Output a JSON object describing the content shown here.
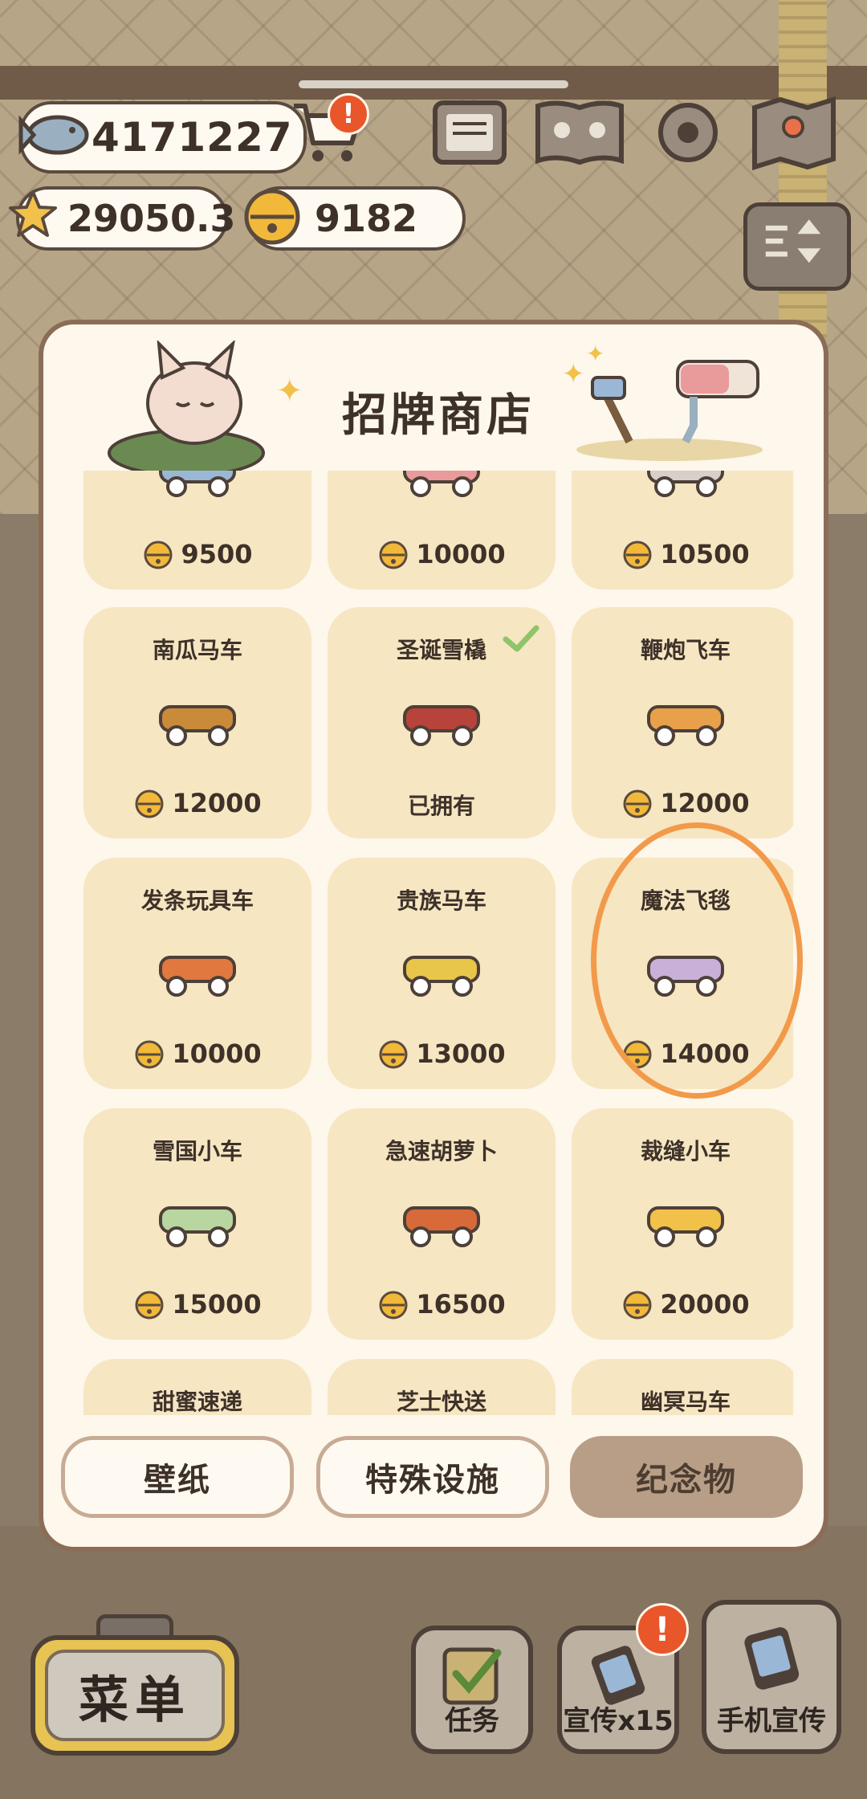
{
  "currency": {
    "fish": "4171227",
    "stars": "29050.3",
    "bells": "9182",
    "cart_badge": "!"
  },
  "modal": {
    "title": "招牌商店"
  },
  "items": [
    {
      "name": "",
      "price": "9500",
      "owned": false
    },
    {
      "name": "",
      "price": "10000",
      "owned": false
    },
    {
      "name": "",
      "price": "10500",
      "owned": false
    },
    {
      "name": "南瓜马车",
      "price": "12000",
      "owned": false
    },
    {
      "name": "圣诞雪橇",
      "price": "",
      "owned": true,
      "owned_label": "已拥有"
    },
    {
      "name": "鞭炮飞车",
      "price": "12000",
      "owned": false
    },
    {
      "name": "发条玩具车",
      "price": "10000",
      "owned": false
    },
    {
      "name": "贵族马车",
      "price": "13000",
      "owned": false
    },
    {
      "name": "魔法飞毯",
      "price": "14000",
      "owned": false
    },
    {
      "name": "雪国小车",
      "price": "15000",
      "owned": false
    },
    {
      "name": "急速胡萝卜",
      "price": "16500",
      "owned": false
    },
    {
      "name": "裁缝小车",
      "price": "20000",
      "owned": false
    },
    {
      "name": "甜蜜速递",
      "price": "",
      "owned": false
    },
    {
      "name": "芝士快送",
      "price": "",
      "owned": false
    },
    {
      "name": "幽冥马车",
      "price": "",
      "owned": false
    }
  ],
  "tabs": {
    "wallpaper": "壁纸",
    "special": "特殊设施",
    "souvenir": "纪念物"
  },
  "bottom": {
    "menu": "菜单",
    "tasks": "任务",
    "promo": "宣传x15",
    "phone_promo": "手机宣传",
    "promo_badge": "!"
  },
  "colors": {
    "card_bg": "#f6e6c2",
    "modal_bg": "#fdf7ec",
    "highlight": "#f29a4a",
    "active_tab": "#b89e87",
    "badge": "#e9562a"
  }
}
